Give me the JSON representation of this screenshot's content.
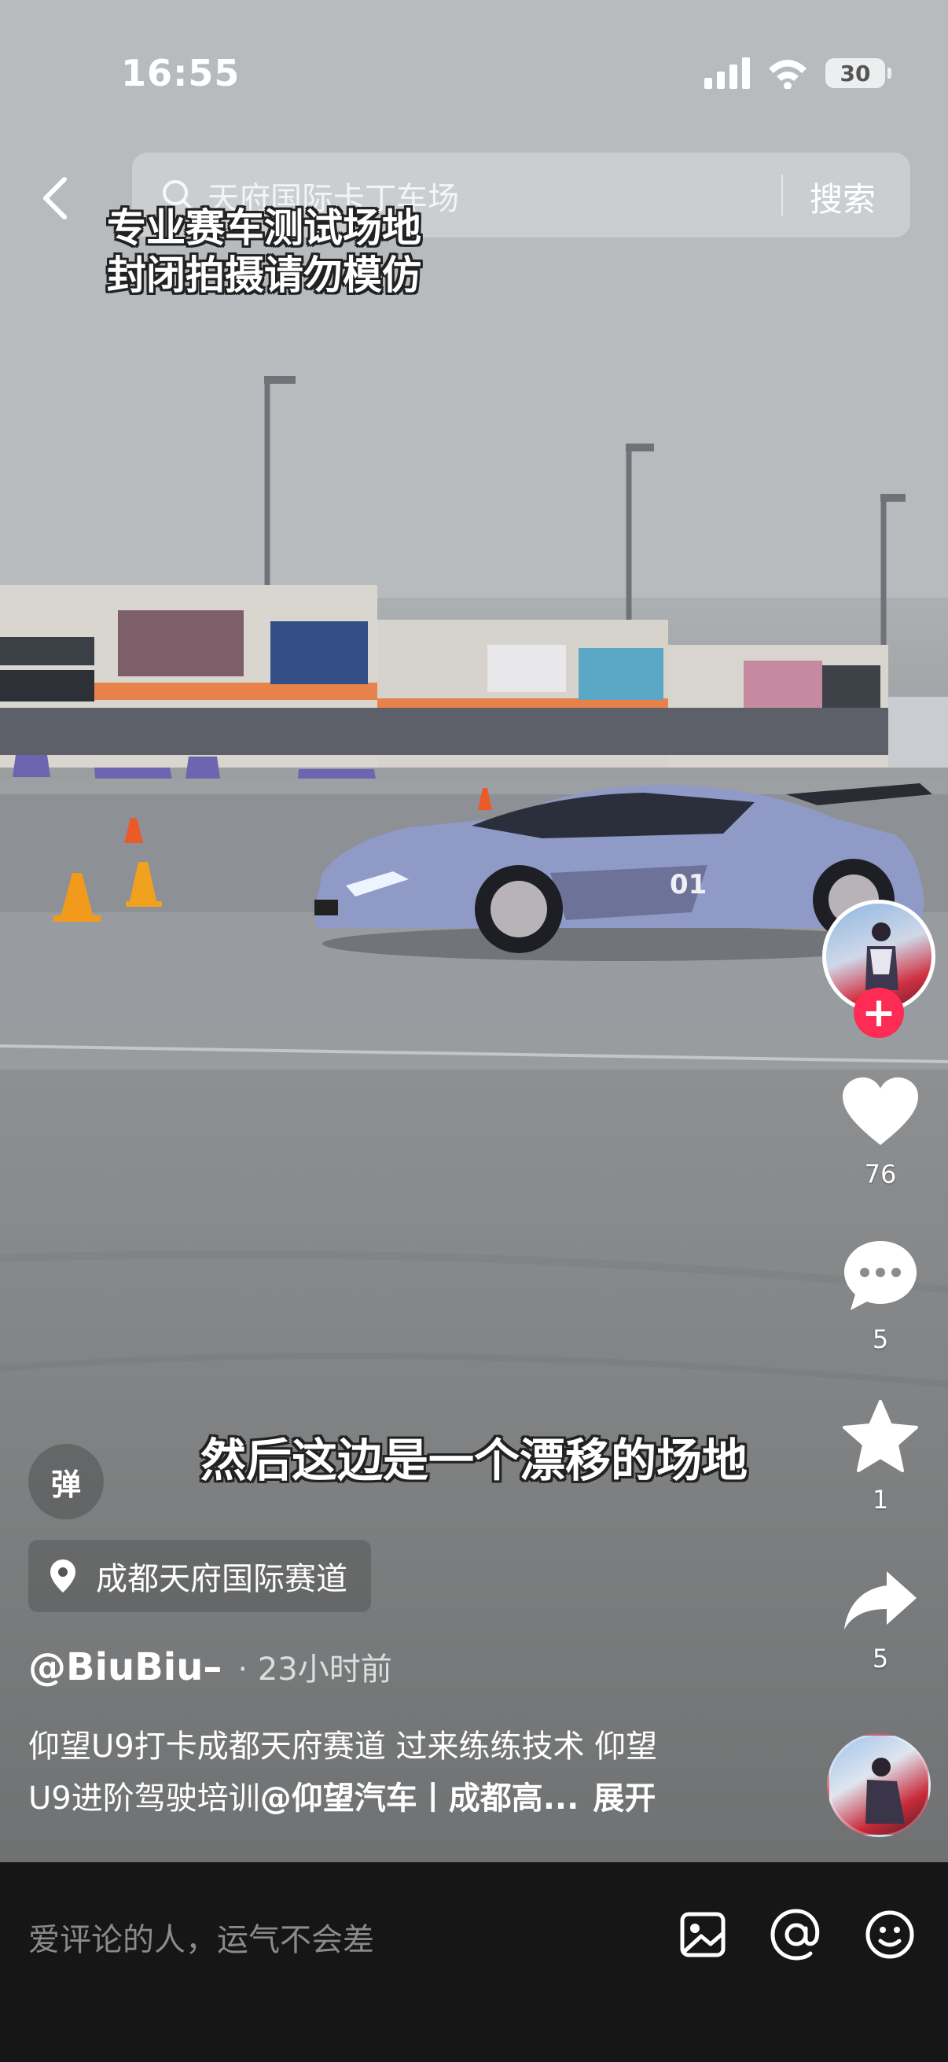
{
  "status_bar": {
    "time": "16:55",
    "battery": "30"
  },
  "top_bar": {
    "back_icon": "chevron-left-icon",
    "search_placeholder": "天府国际卡丁车场",
    "search_button": "搜索"
  },
  "video": {
    "overlay_caption_line1": "专业赛车测试场地",
    "overlay_caption_line2": "封闭拍摄请勿模仿",
    "subtitle": "然后这边是一个漂移的场地",
    "car_badge": "01"
  },
  "actions": {
    "follow_label": "+",
    "likes": "76",
    "comments": "5",
    "favorites": "1",
    "shares": "5"
  },
  "info": {
    "danmu_label": "弹",
    "location": "成都天府国际赛道",
    "author": "@BiuBiu–",
    "time_ago": "· 23小时前",
    "desc_line1": "仰望U9打卡成都天府赛道 过来练练技术 仰望",
    "desc_line2_prefix": "U9进阶驾驶培训",
    "desc_mention": "@仰望汽车丨成都高...",
    "expand": "展开"
  },
  "comment_bar": {
    "placeholder": "爱评论的人，运气不会差"
  },
  "colors": {
    "accent_red": "#fe2c55",
    "car": "#8f9ac6",
    "bottom_bar": "#161616"
  }
}
